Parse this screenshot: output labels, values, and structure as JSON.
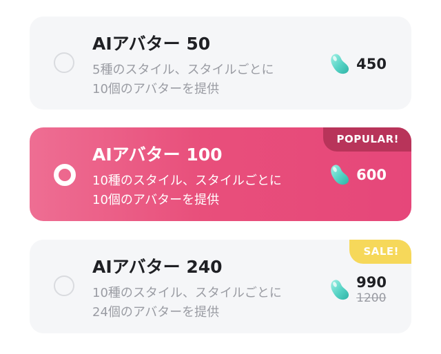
{
  "plans": [
    {
      "title": "AIアバター 50",
      "desc_line1": "5種のスタイル、スタイルごとに",
      "desc_line2": "10個のアバターを提供",
      "price": "450",
      "selected": false
    },
    {
      "title": "AIアバター 100",
      "desc_line1": "10種のスタイル、スタイルごとに",
      "desc_line2": "10個のアバターを提供",
      "price": "600",
      "badge": "POPULAR!",
      "selected": true
    },
    {
      "title": "AIアバター 240",
      "desc_line1": "10種のスタイル、スタイルごとに",
      "desc_line2": "24個のアバターを提供",
      "price": "990",
      "original_price": "1200",
      "badge": "SALE!",
      "selected": false
    }
  ],
  "icons": {
    "currency": "jelly-bean-icon"
  },
  "colors": {
    "selected_card": "#e84f7b",
    "popular_badge": "#b8345a",
    "sale_badge": "#f6d85a",
    "bean": "#5fd6c8",
    "card_bg": "#f5f6f8"
  }
}
